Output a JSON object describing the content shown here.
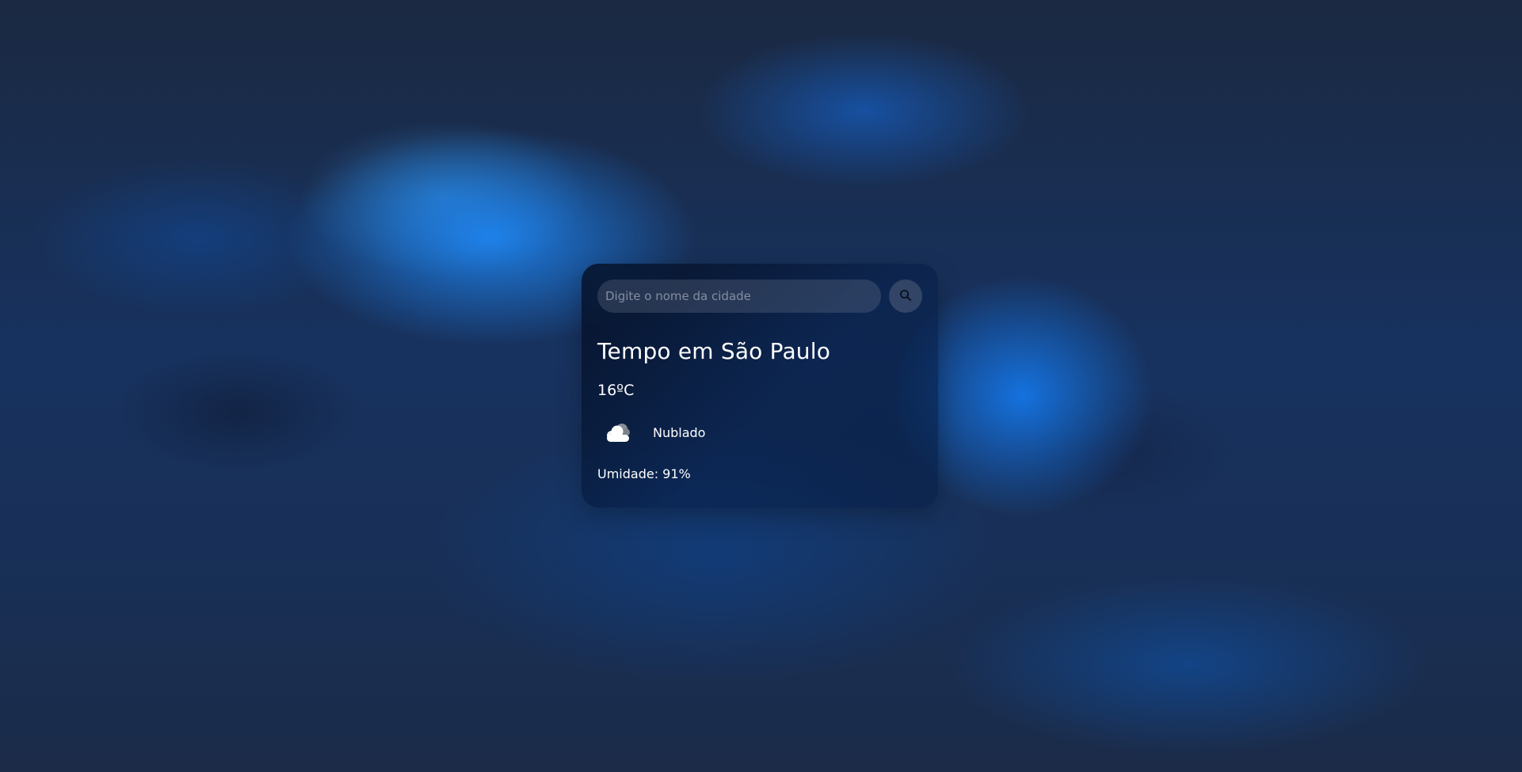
{
  "search": {
    "placeholder": "Digite o nome da cidade",
    "value": "",
    "button_icon": "search-icon"
  },
  "weather": {
    "title": "Tempo em São Paulo",
    "temperature": "16ºC",
    "condition_icon": "cloudy-icon",
    "condition": "Nublado",
    "humidity": "Umidade: 91%"
  },
  "colors": {
    "background": "#1c2a48",
    "accent": "#1e8cff",
    "text": "#ffffff"
  }
}
